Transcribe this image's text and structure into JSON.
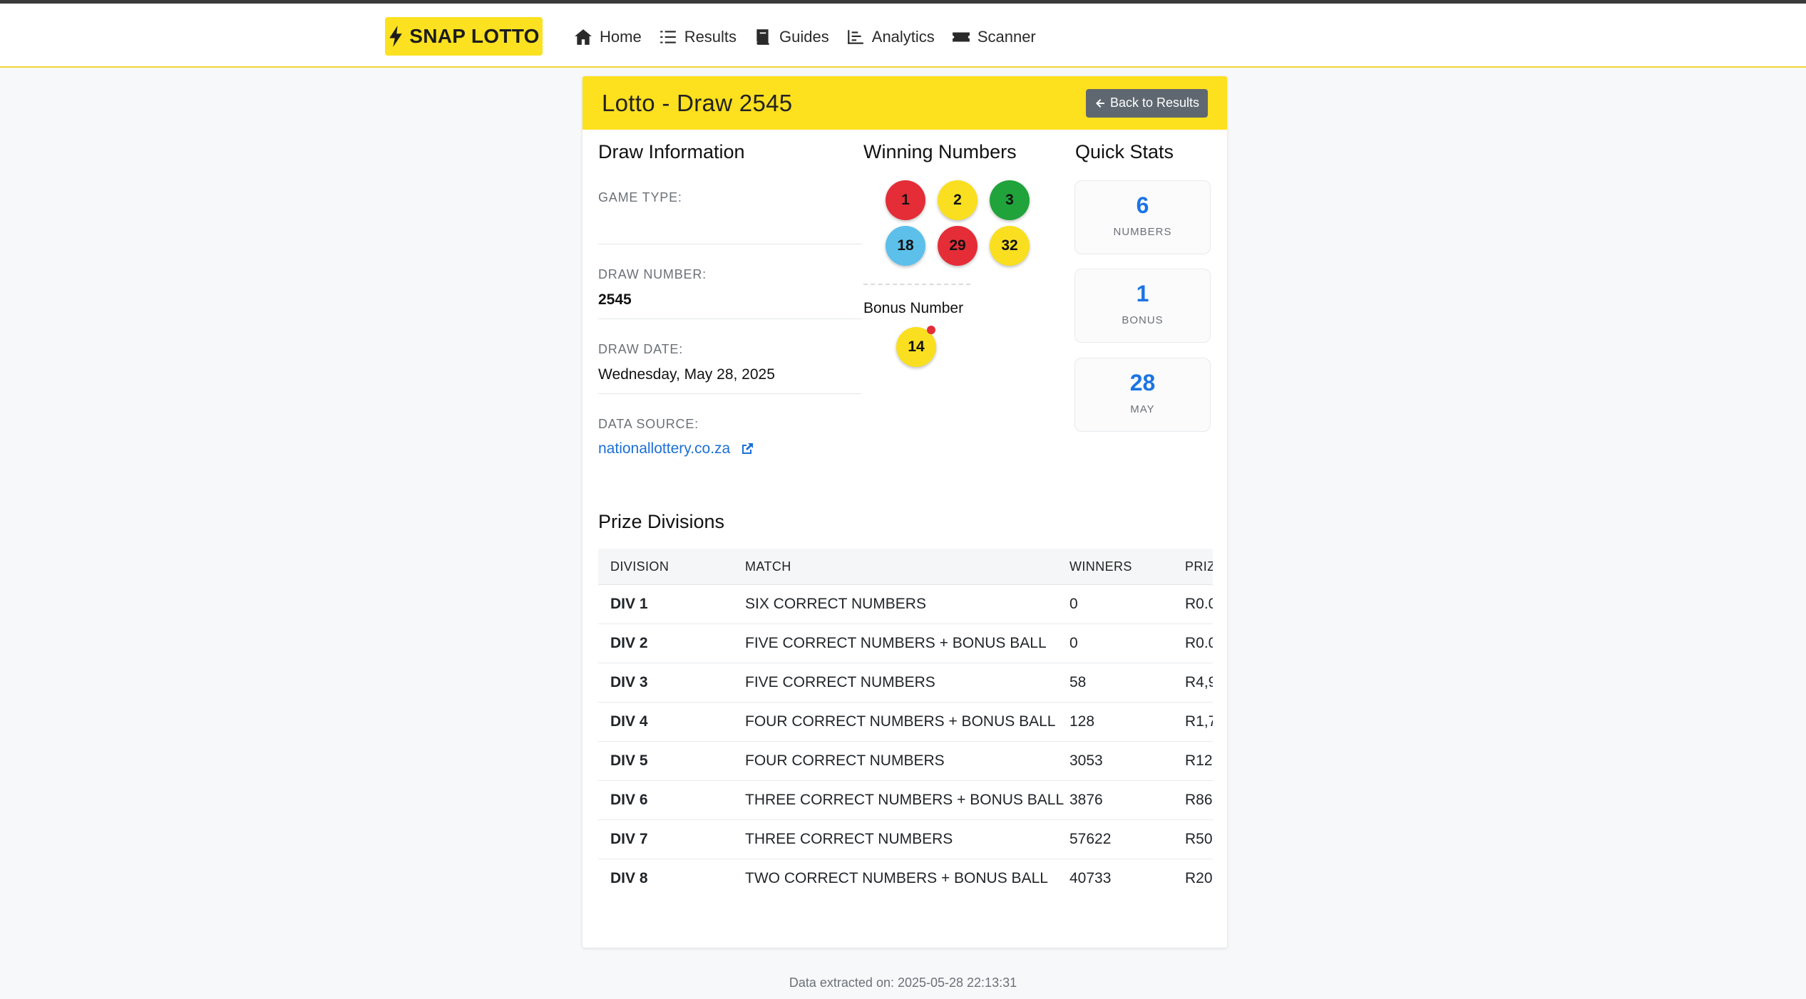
{
  "nav": {
    "brand": "SNAP LOTTO",
    "items": [
      {
        "label": "Home",
        "icon": "home-icon"
      },
      {
        "label": "Results",
        "icon": "list-icon"
      },
      {
        "label": "Guides",
        "icon": "book-icon"
      },
      {
        "label": "Analytics",
        "icon": "chart-icon"
      },
      {
        "label": "Scanner",
        "icon": "ticket-icon"
      }
    ]
  },
  "header": {
    "title": "Lotto - Draw 2545",
    "back_label": "Back to Results"
  },
  "draw_info": {
    "heading": "Draw Information",
    "game_type_label": "GAME TYPE:",
    "game_type_value": "",
    "draw_number_label": "DRAW NUMBER:",
    "draw_number_value": "2545",
    "draw_date_label": "DRAW DATE:",
    "draw_date_value": "Wednesday, May 28, 2025",
    "data_source_label": "DATA SOURCE:",
    "data_source_value": "nationallottery.co.za"
  },
  "winning": {
    "heading": "Winning Numbers",
    "numbers": [
      {
        "value": "1",
        "color": "#e42d37"
      },
      {
        "value": "2",
        "color": "#f9df1f"
      },
      {
        "value": "3",
        "color": "#20a33a"
      },
      {
        "value": "18",
        "color": "#5cc0eb"
      },
      {
        "value": "29",
        "color": "#e42d37"
      },
      {
        "value": "32",
        "color": "#f9df1f"
      }
    ],
    "bonus_heading": "Bonus Number",
    "bonus": "14"
  },
  "quick_stats": {
    "heading": "Quick Stats",
    "stats": [
      {
        "value": "6",
        "caption": "NUMBERS"
      },
      {
        "value": "1",
        "caption": "BONUS"
      },
      {
        "value": "28",
        "caption": "MAY"
      }
    ]
  },
  "prize": {
    "heading": "Prize Divisions",
    "columns": [
      "DIVISION",
      "MATCH",
      "WINNERS",
      "PRIZ"
    ],
    "rows": [
      {
        "division": "DIV 1",
        "match": "SIX CORRECT NUMBERS",
        "winners": "0",
        "prize": "R0.0"
      },
      {
        "division": "DIV 2",
        "match": "FIVE CORRECT NUMBERS + BONUS BALL",
        "winners": "0",
        "prize": "R0.0"
      },
      {
        "division": "DIV 3",
        "match": "FIVE CORRECT NUMBERS",
        "winners": "58",
        "prize": "R4,9"
      },
      {
        "division": "DIV 4",
        "match": "FOUR CORRECT NUMBERS + BONUS BALL",
        "winners": "128",
        "prize": "R1,7"
      },
      {
        "division": "DIV 5",
        "match": "FOUR CORRECT NUMBERS",
        "winners": "3053",
        "prize": "R12."
      },
      {
        "division": "DIV 6",
        "match": "THREE CORRECT NUMBERS + BONUS BALL",
        "winners": "3876",
        "prize": "R86"
      },
      {
        "division": "DIV 7",
        "match": "THREE CORRECT NUMBERS",
        "winners": "57622",
        "prize": "R50"
      },
      {
        "division": "DIV 8",
        "match": "TWO CORRECT NUMBERS + BONUS BALL",
        "winners": "40733",
        "prize": "R20"
      }
    ]
  },
  "footer": {
    "text": "Data extracted on: 2025-05-28 22:13:31"
  },
  "colors": {
    "accent": "#fde01e",
    "link": "#1b6fd8",
    "stat_number": "#1b74e4"
  }
}
